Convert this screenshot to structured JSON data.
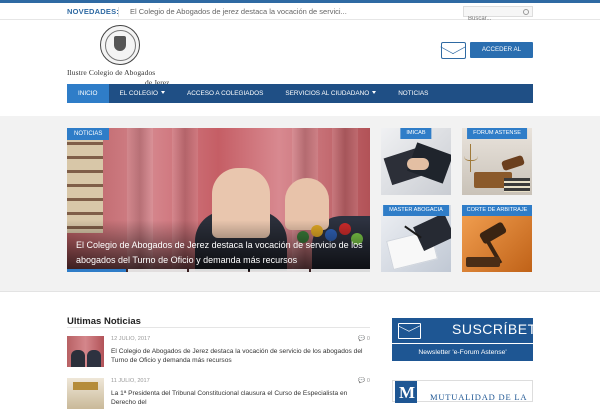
{
  "topbar": {
    "label": "NOVEDADES:",
    "ticker": "El Colegio de Abogados de jerez destaca la vocación de servici...",
    "search_placeholder": "Buscar..."
  },
  "logo": {
    "line1": "Ilustre Colegio de Abogados",
    "line2": "de Jerez"
  },
  "header": {
    "access_label": "ACCEDER AL CORREO"
  },
  "nav": [
    {
      "label": "INICIO",
      "active": true,
      "dropdown": false
    },
    {
      "label": "EL COLEGIO",
      "active": false,
      "dropdown": true
    },
    {
      "label": "ACCESO A COLEGIADOS",
      "active": false,
      "dropdown": false
    },
    {
      "label": "SERVICIOS AL CIUDADANO",
      "active": false,
      "dropdown": true
    },
    {
      "label": "NOTICIAS",
      "active": false,
      "dropdown": false
    }
  ],
  "slider": {
    "badge": "NOTICIAS",
    "title": "El Colegio de Abogados de Jerez destaca la vocación de servicio de los abogados del Turno de Oficio y demanda más recursos"
  },
  "tiles": [
    {
      "label": "IMICAB"
    },
    {
      "label": "FORUM ASTENSE"
    },
    {
      "label": "MASTER ABOGACIA"
    },
    {
      "label": "CORTE DE ARBITRAJE"
    }
  ],
  "latest": {
    "heading": "Ultimas Noticias",
    "items": [
      {
        "date": "12 JULIO, 2017",
        "comments": "0",
        "title": "El Colegio de Abogados de Jerez destaca la vocación de servicio de los abogados del Turno de Oficio y demanda más recursos"
      },
      {
        "date": "11 JULIO, 2017",
        "comments": "0",
        "title": "La 1ª Presidenta del Tribunal Constitucional clausura el Curso de Especialista en Derecho del"
      }
    ]
  },
  "sidebar": {
    "subscribe": "SUSCRÍBETE",
    "newsletter": "Newsletter 'e-Forum Astense'",
    "mutualidad": "MUTUALIDAD DE LA"
  },
  "colors": {
    "brand": "#1f4f85",
    "accent": "#2f7dc8"
  }
}
